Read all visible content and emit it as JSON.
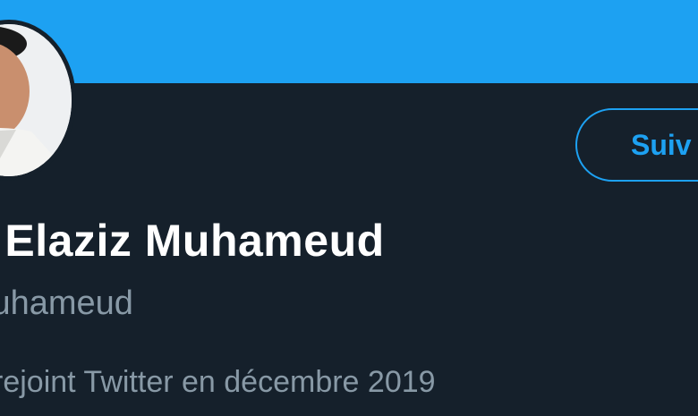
{
  "profile": {
    "display_name": "d Elaziz Muhameud",
    "handle": "luhameud",
    "joined": "rejoint Twitter en décembre 2019"
  },
  "follow_button": {
    "label": "Suiv"
  },
  "colors": {
    "banner": "#1da1f2",
    "background": "#15202b",
    "accent": "#1da1f2",
    "secondary_text": "#8899a6"
  },
  "avatar": {
    "icon": "profile-photo"
  }
}
